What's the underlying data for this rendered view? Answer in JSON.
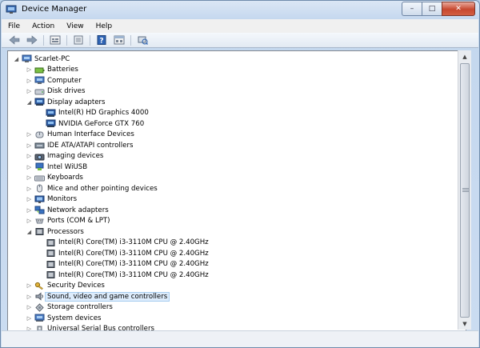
{
  "window": {
    "title": "Device Manager",
    "buttons": {
      "minimize": "–",
      "maximize": "□",
      "close": "✕"
    }
  },
  "menu": [
    "File",
    "Action",
    "View",
    "Help"
  ],
  "toolbar": [
    "back-icon",
    "forward-icon",
    "properties-icon",
    "show-hidden-icon",
    "help-icon",
    "view-icon",
    "scan-hardware-icon"
  ],
  "tree": {
    "root": "Scarlet-PC",
    "items": [
      {
        "label": "Batteries",
        "level": 1,
        "state": "collapsed",
        "icon": "battery-icon"
      },
      {
        "label": "Computer",
        "level": 1,
        "state": "collapsed",
        "icon": "computer-icon"
      },
      {
        "label": "Disk drives",
        "level": 1,
        "state": "collapsed",
        "icon": "disk-drive-icon"
      },
      {
        "label": "Display adapters",
        "level": 1,
        "state": "expanded",
        "icon": "display-adapter-icon"
      },
      {
        "label": "Intel(R) HD Graphics 4000",
        "level": 2,
        "state": "leaf",
        "icon": "display-adapter-icon"
      },
      {
        "label": "NVIDIA GeForce GTX 760",
        "level": 2,
        "state": "leaf",
        "icon": "display-adapter-icon"
      },
      {
        "label": "Human Interface Devices",
        "level": 1,
        "state": "collapsed",
        "icon": "hid-icon"
      },
      {
        "label": "IDE ATA/ATAPI controllers",
        "level": 1,
        "state": "collapsed",
        "icon": "ide-controller-icon"
      },
      {
        "label": "Imaging devices",
        "level": 1,
        "state": "collapsed",
        "icon": "camera-icon"
      },
      {
        "label": "Intel WiUSB",
        "level": 1,
        "state": "collapsed",
        "icon": "usb-network-icon"
      },
      {
        "label": "Keyboards",
        "level": 1,
        "state": "collapsed",
        "icon": "keyboard-icon"
      },
      {
        "label": "Mice and other pointing devices",
        "level": 1,
        "state": "collapsed",
        "icon": "mouse-icon"
      },
      {
        "label": "Monitors",
        "level": 1,
        "state": "collapsed",
        "icon": "monitor-icon"
      },
      {
        "label": "Network adapters",
        "level": 1,
        "state": "collapsed",
        "icon": "network-adapter-icon"
      },
      {
        "label": "Ports (COM & LPT)",
        "level": 1,
        "state": "collapsed",
        "icon": "port-icon"
      },
      {
        "label": "Processors",
        "level": 1,
        "state": "expanded",
        "icon": "processor-icon"
      },
      {
        "label": "Intel(R) Core(TM) i3-3110M CPU @ 2.40GHz",
        "level": 2,
        "state": "leaf",
        "icon": "processor-icon"
      },
      {
        "label": "Intel(R) Core(TM) i3-3110M CPU @ 2.40GHz",
        "level": 2,
        "state": "leaf",
        "icon": "processor-icon"
      },
      {
        "label": "Intel(R) Core(TM) i3-3110M CPU @ 2.40GHz",
        "level": 2,
        "state": "leaf",
        "icon": "processor-icon"
      },
      {
        "label": "Intel(R) Core(TM) i3-3110M CPU @ 2.40GHz",
        "level": 2,
        "state": "leaf",
        "icon": "processor-icon"
      },
      {
        "label": "Security Devices",
        "level": 1,
        "state": "collapsed",
        "icon": "security-key-icon"
      },
      {
        "label": "Sound, video and game controllers",
        "level": 1,
        "state": "collapsed",
        "icon": "speaker-icon",
        "selected": true
      },
      {
        "label": "Storage controllers",
        "level": 1,
        "state": "collapsed",
        "icon": "storage-controller-icon"
      },
      {
        "label": "System devices",
        "level": 1,
        "state": "collapsed",
        "icon": "system-device-icon"
      },
      {
        "label": "Universal Serial Bus controllers",
        "level": 1,
        "state": "collapsed",
        "icon": "usb-controller-icon"
      }
    ]
  },
  "colors": {
    "selection": "#ddecfc",
    "frame": "#b9d1ea"
  }
}
